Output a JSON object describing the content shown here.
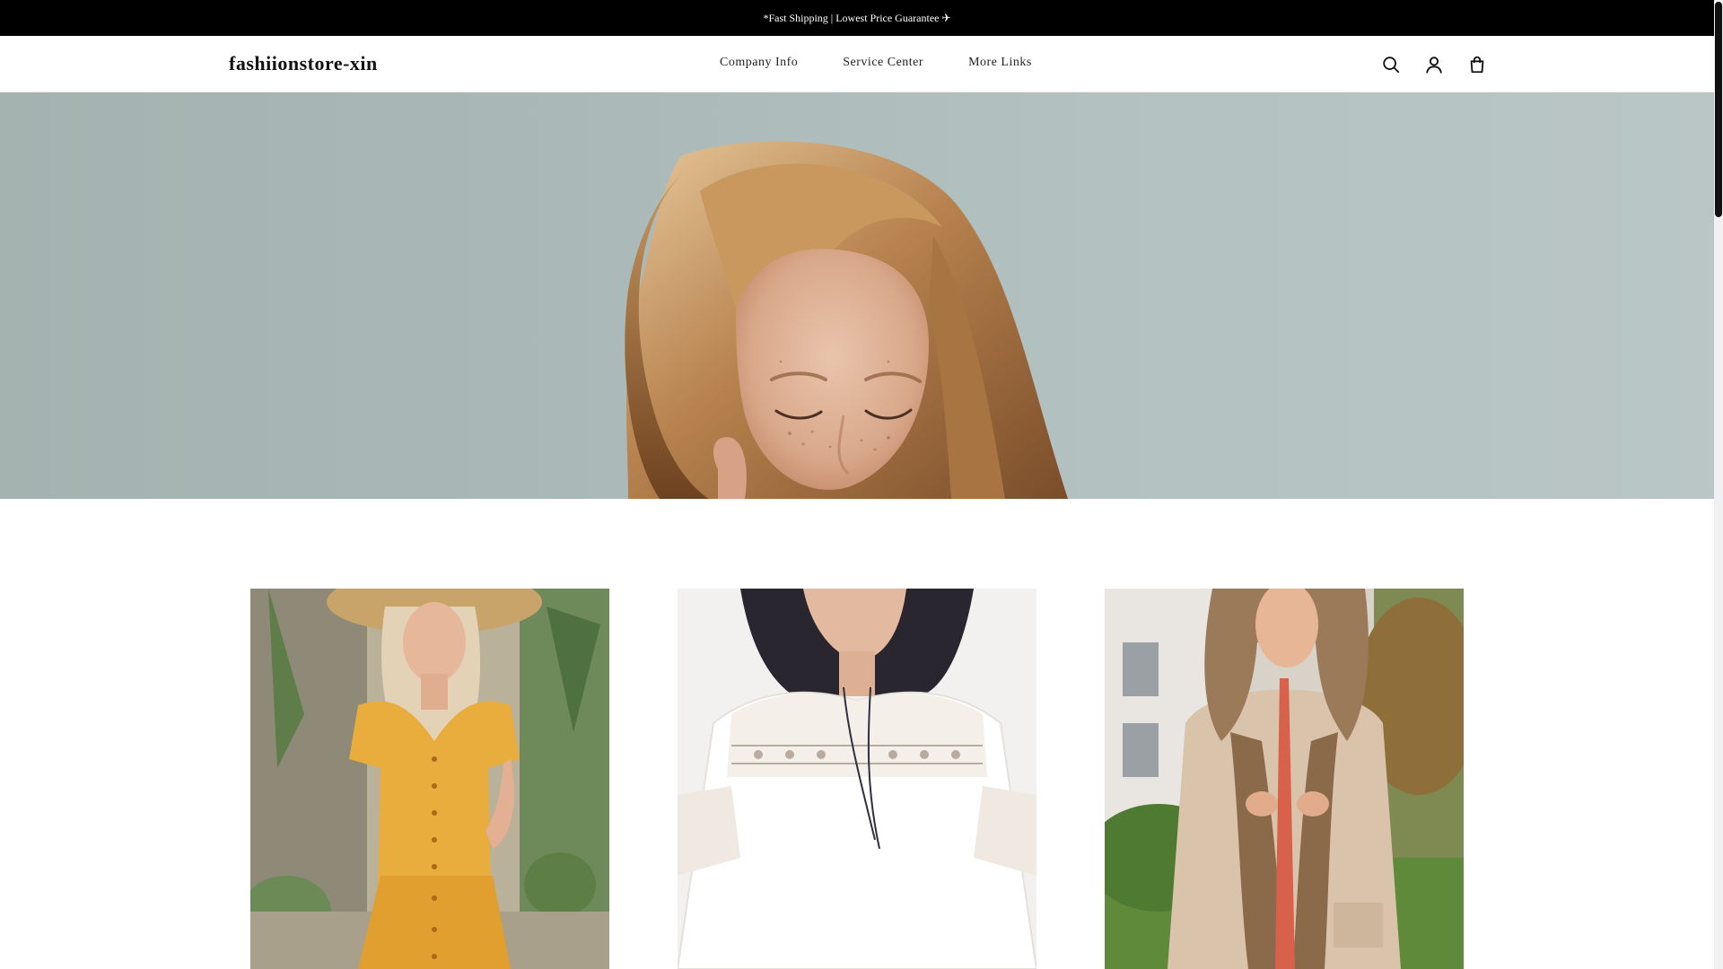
{
  "announcement": {
    "text": "*Fast Shipping | Lowest Price Guarantee ✈"
  },
  "header": {
    "logo": "fashiionstore-xin",
    "nav": [
      {
        "label": "Company Info"
      },
      {
        "label": "Service Center"
      },
      {
        "label": "More Links"
      }
    ],
    "icons": [
      "search-icon",
      "account-icon",
      "cart-icon"
    ]
  },
  "colors": {
    "announcement_bg": "#000000",
    "hero_bg": "#a9b8b7",
    "scroll_thumb": "#111111"
  }
}
